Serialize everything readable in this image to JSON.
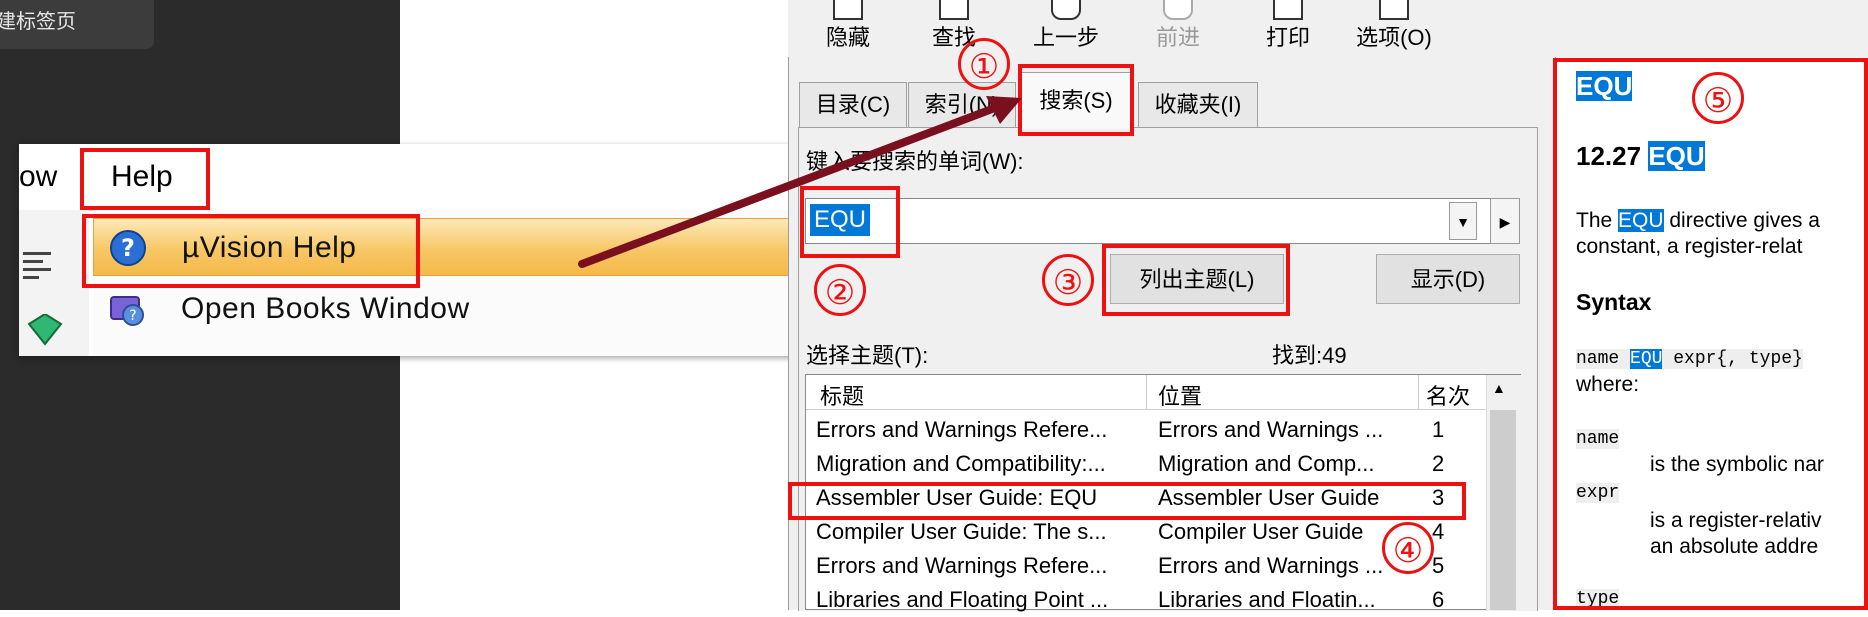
{
  "browser_tab": {
    "label": "建标签页"
  },
  "menu": {
    "bar_items": [
      "ow",
      "Help"
    ],
    "dropdown_items": [
      {
        "label": "µVision Help",
        "icon": "help-question-icon"
      },
      {
        "label": "Open Books Window",
        "icon": "books-icon"
      }
    ]
  },
  "toolbar": {
    "buttons": [
      {
        "label": "隐藏",
        "icon": "hide-icon"
      },
      {
        "label": "查找",
        "icon": "find-icon"
      },
      {
        "label": "上一步",
        "icon": "back-arrow-icon"
      },
      {
        "label": "前进",
        "icon": "forward-arrow-icon",
        "disabled": true
      },
      {
        "label": "打印",
        "icon": "print-icon"
      },
      {
        "label": "选项(O)",
        "icon": "options-icon"
      }
    ]
  },
  "tabs": [
    {
      "label": "目录(C)"
    },
    {
      "label": "索引(N)"
    },
    {
      "label": "搜索(S)",
      "active": true
    },
    {
      "label": "收藏夹(I)"
    }
  ],
  "search": {
    "prompt_label": "键入要搜索的单词(W):",
    "value": "EQU",
    "list_topics_button": "列出主题(L)",
    "display_button": "显示(D)",
    "select_topic_label": "选择主题(T):",
    "found_label": "找到:49"
  },
  "results": {
    "columns": [
      "标题",
      "位置",
      "名次"
    ],
    "rows": [
      {
        "title": "Errors and Warnings Refere...",
        "location": "Errors and Warnings ...",
        "rank": "1"
      },
      {
        "title": "Migration and Compatibility:...",
        "location": "Migration and Comp...",
        "rank": "2"
      },
      {
        "title": "Assembler User Guide: EQU",
        "location": "Assembler User Guide",
        "rank": "3"
      },
      {
        "title": "Compiler User Guide: The s...",
        "location": "Compiler User Guide",
        "rank": "4"
      },
      {
        "title": "Errors and Warnings Refere...",
        "location": "Errors and Warnings ...",
        "rank": "5"
      },
      {
        "title": "Libraries and Floating Point ...",
        "location": "Libraries and Floatin...",
        "rank": "6"
      }
    ]
  },
  "content": {
    "heading_hl": "EQU",
    "section_num": "12.27",
    "section_hl": "EQU",
    "para1_pre": "The ",
    "para1_hl": "EQU",
    "para1_post": " directive gives a",
    "para2": "constant, a register-relat",
    "syntax_heading": "Syntax",
    "syntax_pre": "name ",
    "syntax_hl": "EQU",
    "syntax_post": " expr{, type}",
    "where": "where:",
    "term_name": "name",
    "desc_name": "is the symbolic nar",
    "term_expr": "expr",
    "desc_expr_1": "is a register-relativ",
    "desc_expr_2": "an absolute addre",
    "term_type": "type"
  },
  "annotations": [
    "①",
    "②",
    "③",
    "④",
    "⑤"
  ],
  "colors": {
    "annotation_red": "#ee1111",
    "selection_blue": "#0078d7",
    "arrow": "#7a0f1e"
  }
}
